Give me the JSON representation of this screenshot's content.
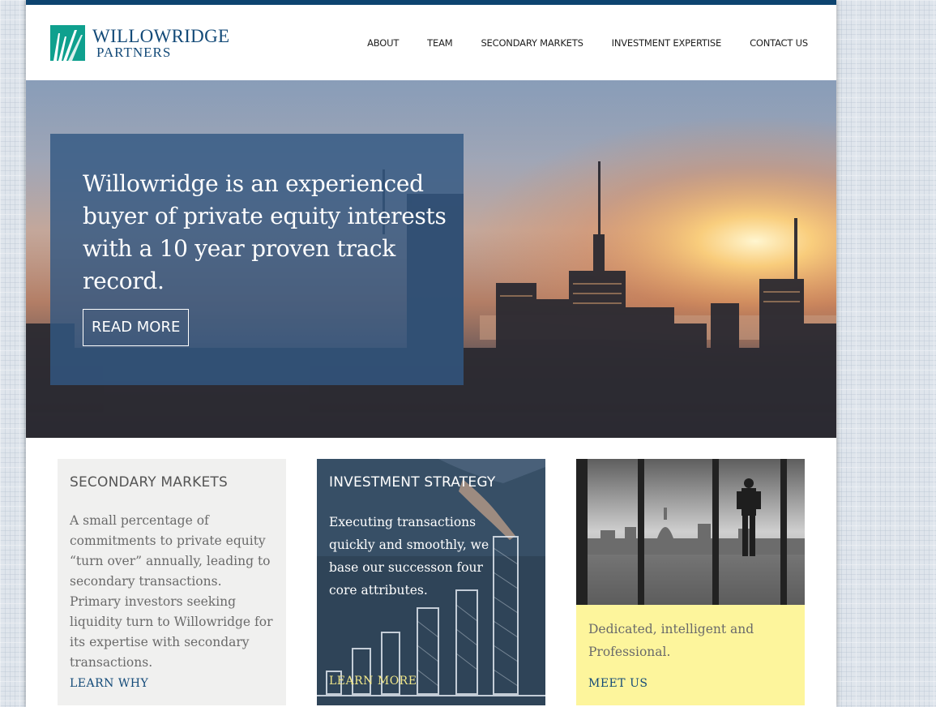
{
  "brand": {
    "name": "WILLOWRIDGE",
    "subtitle": "PARTNERS",
    "logo_icon": "willowridge-w-logo",
    "colors": {
      "navy": "#134a78",
      "teal": "#0fa08e",
      "topbar": "#0d4470"
    }
  },
  "nav": {
    "items": [
      {
        "label": "ABOUT"
      },
      {
        "label": "TEAM"
      },
      {
        "label": "SECONDARY MARKETS"
      },
      {
        "label": "INVESTMENT EXPERTISE"
      },
      {
        "label": "CONTACT US"
      }
    ]
  },
  "hero": {
    "headline": "Willowridge is an experienced buyer of private equity interests with a 10 year proven track record.",
    "button_label": "READ MORE",
    "image": "city-skyline-sunset"
  },
  "cards": [
    {
      "title": "SECONDARY MARKETS",
      "text": "A small percentage of commitments to private equity “turn over” annually, leading to secondary transactions. Primary investors seeking liquidity turn to Willowridge for its expertise with secondary transactions.",
      "link": "LEARN WHY"
    },
    {
      "title": "INVESTMENT STRATEGY",
      "text": "Executing transactions quickly and smoothly, we base our successon four core attributes.",
      "link": "LEARN MORE",
      "image": "hand-drawing-bar-chart"
    },
    {
      "text": "Dedicated, intelligent and Professional.",
      "link": "MEET US",
      "image": "man-looking-at-city"
    }
  ]
}
